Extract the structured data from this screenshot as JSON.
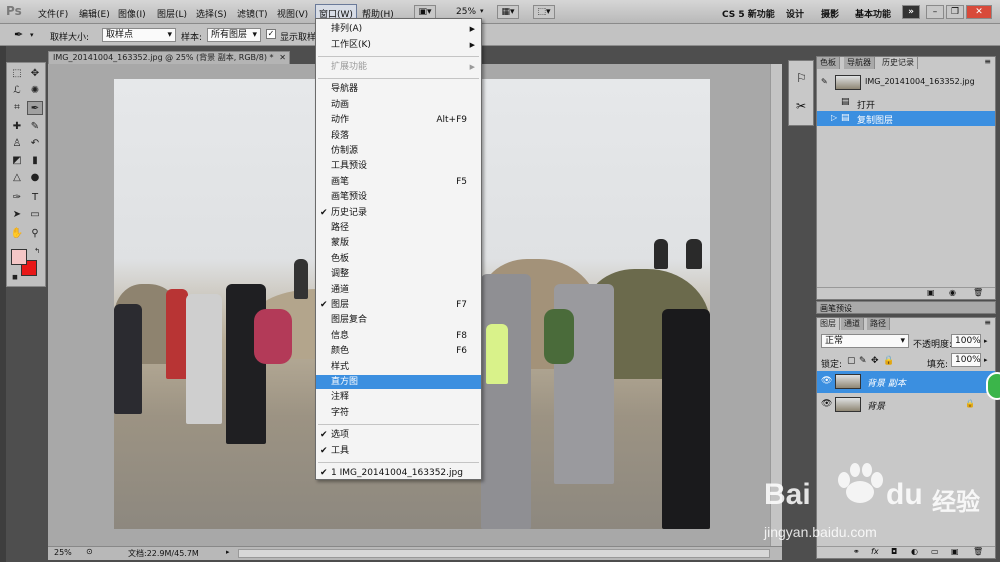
{
  "app": {
    "logo": "Ps"
  },
  "menubar": {
    "items": [
      "文件(F)",
      "编辑(E)",
      "图像(I)",
      "图层(L)",
      "选择(S)",
      "滤镜(T)",
      "视图(V)",
      "窗口(W)",
      "帮助(H)"
    ],
    "zoom": "25%",
    "workspaces": [
      "CS 5 新功能",
      "设计",
      "摄影",
      "基本功能"
    ],
    "more": "»"
  },
  "options": {
    "sample_size_label": "取样大小:",
    "sample_size_value": "取样点",
    "sample_label": "样本:",
    "sample_value": "所有图层",
    "show_ring_label": "显示取样环"
  },
  "document": {
    "tab_title": "IMG_20141004_163352.jpg @ 25% (背景 副本, RGB/8) *",
    "status_zoom": "25%",
    "status_doc": "文档:22.9M/45.7M"
  },
  "window_menu": {
    "items": [
      {
        "label": "排列(A)",
        "submenu": true
      },
      {
        "label": "工作区(K)",
        "submenu": true
      },
      {
        "sep": true
      },
      {
        "label": "扩展功能",
        "submenu": true,
        "disabled": true
      },
      {
        "sep": true
      },
      {
        "label": "导航器"
      },
      {
        "label": "动画"
      },
      {
        "label": "动作",
        "shortcut": "Alt+F9"
      },
      {
        "label": "段落"
      },
      {
        "label": "仿制源"
      },
      {
        "label": "工具预设"
      },
      {
        "label": "画笔",
        "shortcut": "F5"
      },
      {
        "label": "画笔预设"
      },
      {
        "label": "历史记录",
        "checked": true
      },
      {
        "label": "路径"
      },
      {
        "label": "蒙版"
      },
      {
        "label": "色板"
      },
      {
        "label": "调整"
      },
      {
        "label": "通道"
      },
      {
        "label": "图层",
        "checked": true,
        "shortcut": "F7"
      },
      {
        "label": "图层复合"
      },
      {
        "label": "信息",
        "shortcut": "F8"
      },
      {
        "label": "颜色",
        "shortcut": "F6"
      },
      {
        "label": "样式"
      },
      {
        "label": "直方图",
        "highlighted": true
      },
      {
        "label": "注释"
      },
      {
        "label": "字符"
      },
      {
        "sep": true
      },
      {
        "label": "选项",
        "checked": true
      },
      {
        "label": "工具",
        "checked": true
      },
      {
        "sep": true
      },
      {
        "label": "1 IMG_20141004_163352.jpg",
        "checked": true
      }
    ]
  },
  "history_panel": {
    "tabs": [
      "色板",
      "导航器",
      "历史记录"
    ],
    "snapshot": "IMG_20141004_163352.jpg",
    "steps": [
      "打开",
      "复制图层"
    ]
  },
  "brush_panel": {
    "tab": "画笔预设"
  },
  "layers_panel": {
    "tabs": [
      "图层",
      "通道",
      "路径"
    ],
    "blend_mode": "正常",
    "opacity_label": "不透明度:",
    "opacity": "100%",
    "lock_label": "锁定:",
    "fill_label": "填充:",
    "fill": "100%",
    "layers": [
      "背景 副本",
      "背景"
    ]
  },
  "watermark": {
    "brand": "Bai",
    "brand2": "du",
    "cn": "经验",
    "url": "jingyan.baidu.com"
  },
  "colors": {
    "highlight": "#3b8fe0",
    "foreground": "#f4c6c6",
    "background": "#e81818"
  }
}
